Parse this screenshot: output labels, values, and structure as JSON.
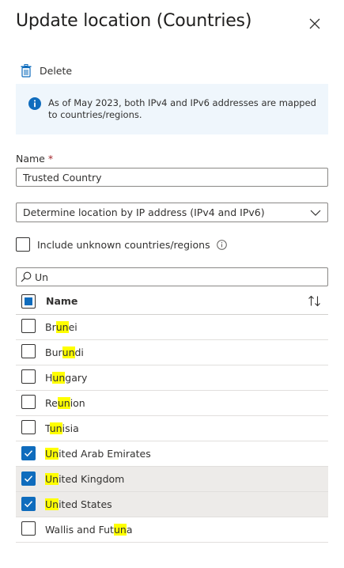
{
  "panel": {
    "title": "Update location (Countries)"
  },
  "toolbar": {
    "delete_label": "Delete"
  },
  "info": {
    "message": "As of May 2023, both IPv4 and IPv6 addresses are mapped to countries/regions."
  },
  "form": {
    "name_label": "Name",
    "name_required": "*",
    "name_value": "Trusted Country",
    "location_method": "Determine location by IP address (IPv4 and IPv6)",
    "include_unknown_label": "Include unknown countries/regions"
  },
  "search": {
    "value": "Un"
  },
  "table": {
    "header": "Name",
    "rows": [
      {
        "parts": [
          "Br",
          "un",
          "ei"
        ],
        "checked": false
      },
      {
        "parts": [
          "Bur",
          "un",
          "di"
        ],
        "checked": false
      },
      {
        "parts": [
          "H",
          "un",
          "gary"
        ],
        "checked": false
      },
      {
        "parts": [
          "Re",
          "un",
          "ion"
        ],
        "checked": false
      },
      {
        "parts": [
          "T",
          "un",
          "isia"
        ],
        "checked": false
      },
      {
        "parts": [
          "",
          "Un",
          "ited Arab Emirates"
        ],
        "checked": true
      },
      {
        "parts": [
          "",
          "Un",
          "ited Kingdom"
        ],
        "checked": true
      },
      {
        "parts": [
          "",
          "Un",
          "ited States"
        ],
        "checked": true
      },
      {
        "parts": [
          "Wallis and Fut",
          "un",
          "a"
        ],
        "checked": false
      }
    ]
  },
  "colors": {
    "accent": "#0f6cbd",
    "highlight": "#ffff00",
    "info_bg": "#eff6fc",
    "selected_row": "#edebe9"
  }
}
